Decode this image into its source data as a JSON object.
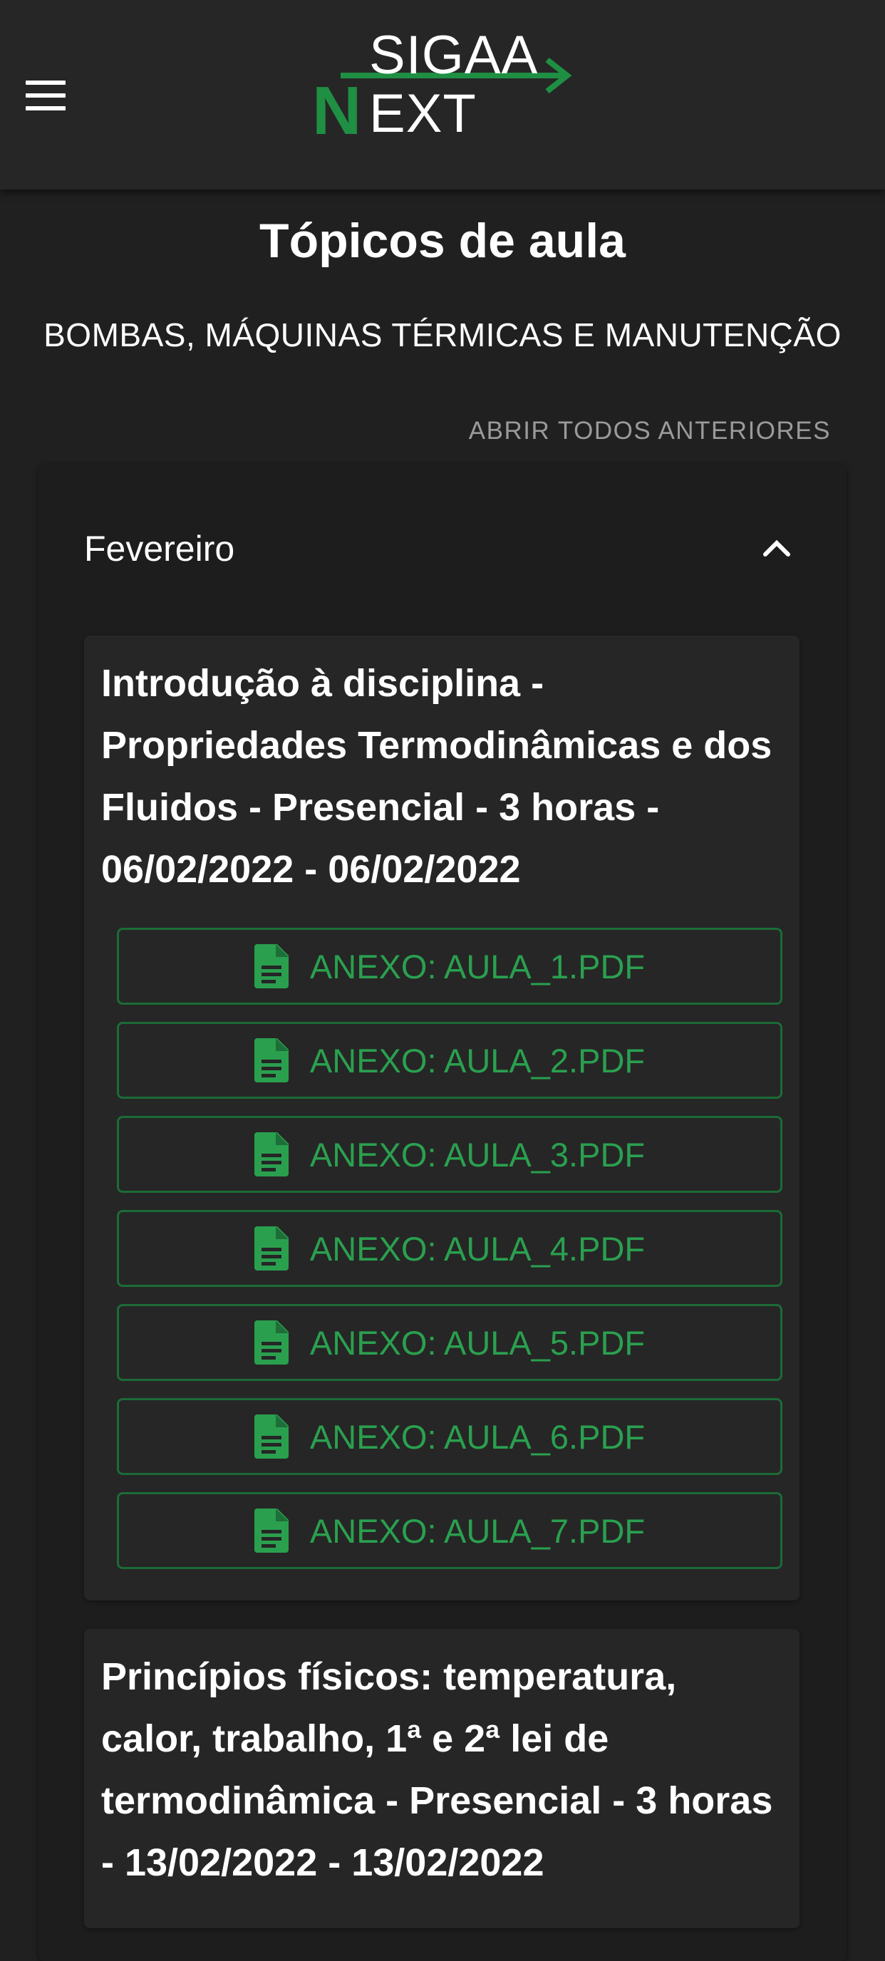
{
  "app": {
    "logo_top": "SIGAA",
    "logo_n": "N",
    "logo_ext": "EXT",
    "menu_icon": "hamburger-menu-icon"
  },
  "header": {
    "title": "Tópicos de aula",
    "course": "BOMBAS, MÁQUINAS TÉRMICAS E MANUTENÇÃO",
    "open_all": "ABRIR TODOS ANTERIORES"
  },
  "month": {
    "label": "Fevereiro",
    "toggle_icon": "chevron-up-icon"
  },
  "topics": [
    {
      "title": "Introdução à disciplina - Propriedades Termodinâmicas e dos Fluidos - Presencial - 3 horas - 06/02/2022 - 06/02/2022",
      "attachments": [
        "ANEXO: AULA_1.PDF",
        "ANEXO: AULA_2.PDF",
        "ANEXO: AULA_3.PDF",
        "ANEXO: AULA_4.PDF",
        "ANEXO: AULA_5.PDF",
        "ANEXO: AULA_6.PDF",
        "ANEXO: AULA_7.PDF"
      ]
    },
    {
      "title": "Princípios físicos: temperatura, calor, trabalho, 1ª e 2ª lei de termodinâmica - Presencial - 3 horas - 13/02/2022 - 13/02/2022",
      "attachments": []
    }
  ],
  "colors": {
    "background": "#202020",
    "appbar": "#262626",
    "accent_green": "#2aa04f",
    "attachment_border": "#1c6b37",
    "muted_text": "#9a9a9a"
  }
}
